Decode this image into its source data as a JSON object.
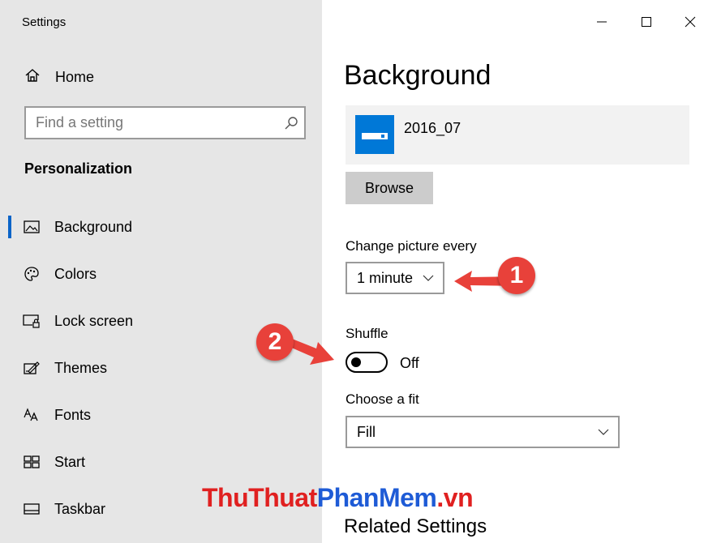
{
  "window": {
    "title": "Settings"
  },
  "sidebar": {
    "home_label": "Home",
    "search_placeholder": "Find a setting",
    "section_title": "Personalization",
    "items": [
      {
        "label": "Background",
        "icon": "picture-icon",
        "active": true
      },
      {
        "label": "Colors",
        "icon": "palette-icon"
      },
      {
        "label": "Lock screen",
        "icon": "lock-screen-icon"
      },
      {
        "label": "Themes",
        "icon": "themes-icon"
      },
      {
        "label": "Fonts",
        "icon": "fonts-icon"
      },
      {
        "label": "Start",
        "icon": "start-icon"
      },
      {
        "label": "Taskbar",
        "icon": "taskbar-icon"
      }
    ]
  },
  "main": {
    "title": "Background",
    "preview_name": "2016_07",
    "browse_label": "Browse",
    "change_label": "Change picture every",
    "change_value": "1 minute",
    "shuffle_label": "Shuffle",
    "shuffle_state": "Off",
    "fit_label": "Choose a fit",
    "fit_value": "Fill",
    "related_title": "Related Settings"
  },
  "annotations": {
    "badge_1": "1",
    "badge_2": "2"
  },
  "watermark": {
    "part1": "ThuThuat",
    "part2": "PhanMem",
    "part3": ".vn"
  },
  "colors": {
    "accent": "#0078d7",
    "sidebar_bg": "#e6e6e6",
    "badge": "#e8413a",
    "watermark_red": "#e02020",
    "watermark_blue": "#1e5bd6"
  }
}
